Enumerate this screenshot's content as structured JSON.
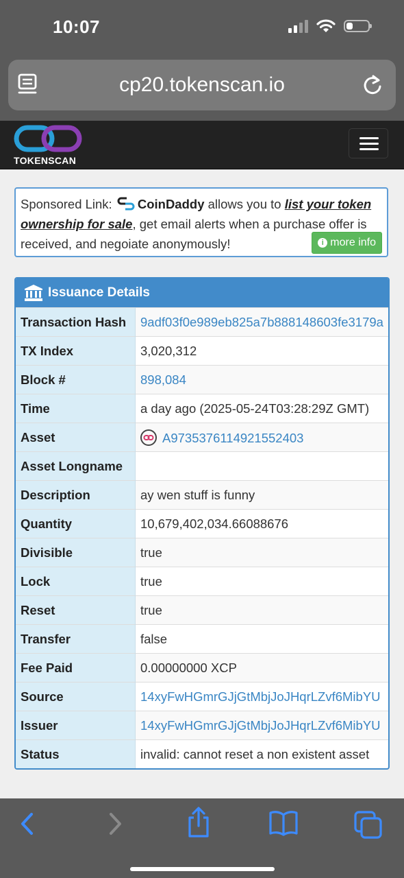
{
  "status_bar": {
    "time": "10:07"
  },
  "browser": {
    "url": "cp20.tokenscan.io"
  },
  "site": {
    "logo_text": "TOKENSCAN"
  },
  "sponsor": {
    "prefix": "Sponsored Link:",
    "brand": "CoinDaddy",
    "mid": " allows you to ",
    "link": "list your token ownership for sale",
    "suffix": ", get email alerts when a purchase offer is received, and negoiate anonymously!",
    "button": "more info"
  },
  "panel": {
    "title": "Issuance Details",
    "rows": [
      {
        "label": "Transaction Hash",
        "value": "9adf03f0e989eb825a7b888148603fe3179a"
      },
      {
        "label": "TX Index",
        "value": "3,020,312"
      },
      {
        "label": "Block #",
        "value": "898,084"
      },
      {
        "label": "Time",
        "value": "a day ago (2025-05-24T03:28:29Z GMT)"
      },
      {
        "label": "Asset",
        "value": "A9735376114921552403"
      },
      {
        "label": "Asset Longname",
        "value": ""
      },
      {
        "label": "Description",
        "value": "ay wen stuff is funny"
      },
      {
        "label": "Quantity",
        "value": "10,679,402,034.66088676"
      },
      {
        "label": "Divisible",
        "value": "true"
      },
      {
        "label": "Lock",
        "value": "true"
      },
      {
        "label": "Reset",
        "value": "true"
      },
      {
        "label": "Transfer",
        "value": "false"
      },
      {
        "label": "Fee Paid",
        "value": "0.00000000 XCP"
      },
      {
        "label": "Source",
        "value": "14xyFwHGmrGJjGtMbjJoJHqrLZvf6MibYU"
      },
      {
        "label": "Issuer",
        "value": "14xyFwHGmrGJjGtMbjJoJHqrLZvf6MibYU"
      },
      {
        "label": "Status",
        "value": "invalid: cannot reset a non existent asset"
      }
    ]
  },
  "colors": {
    "panel_blue": "#428bca",
    "label_bg": "#d9edf7",
    "link": "#3a86c4",
    "button_green": "#5cb85c"
  }
}
